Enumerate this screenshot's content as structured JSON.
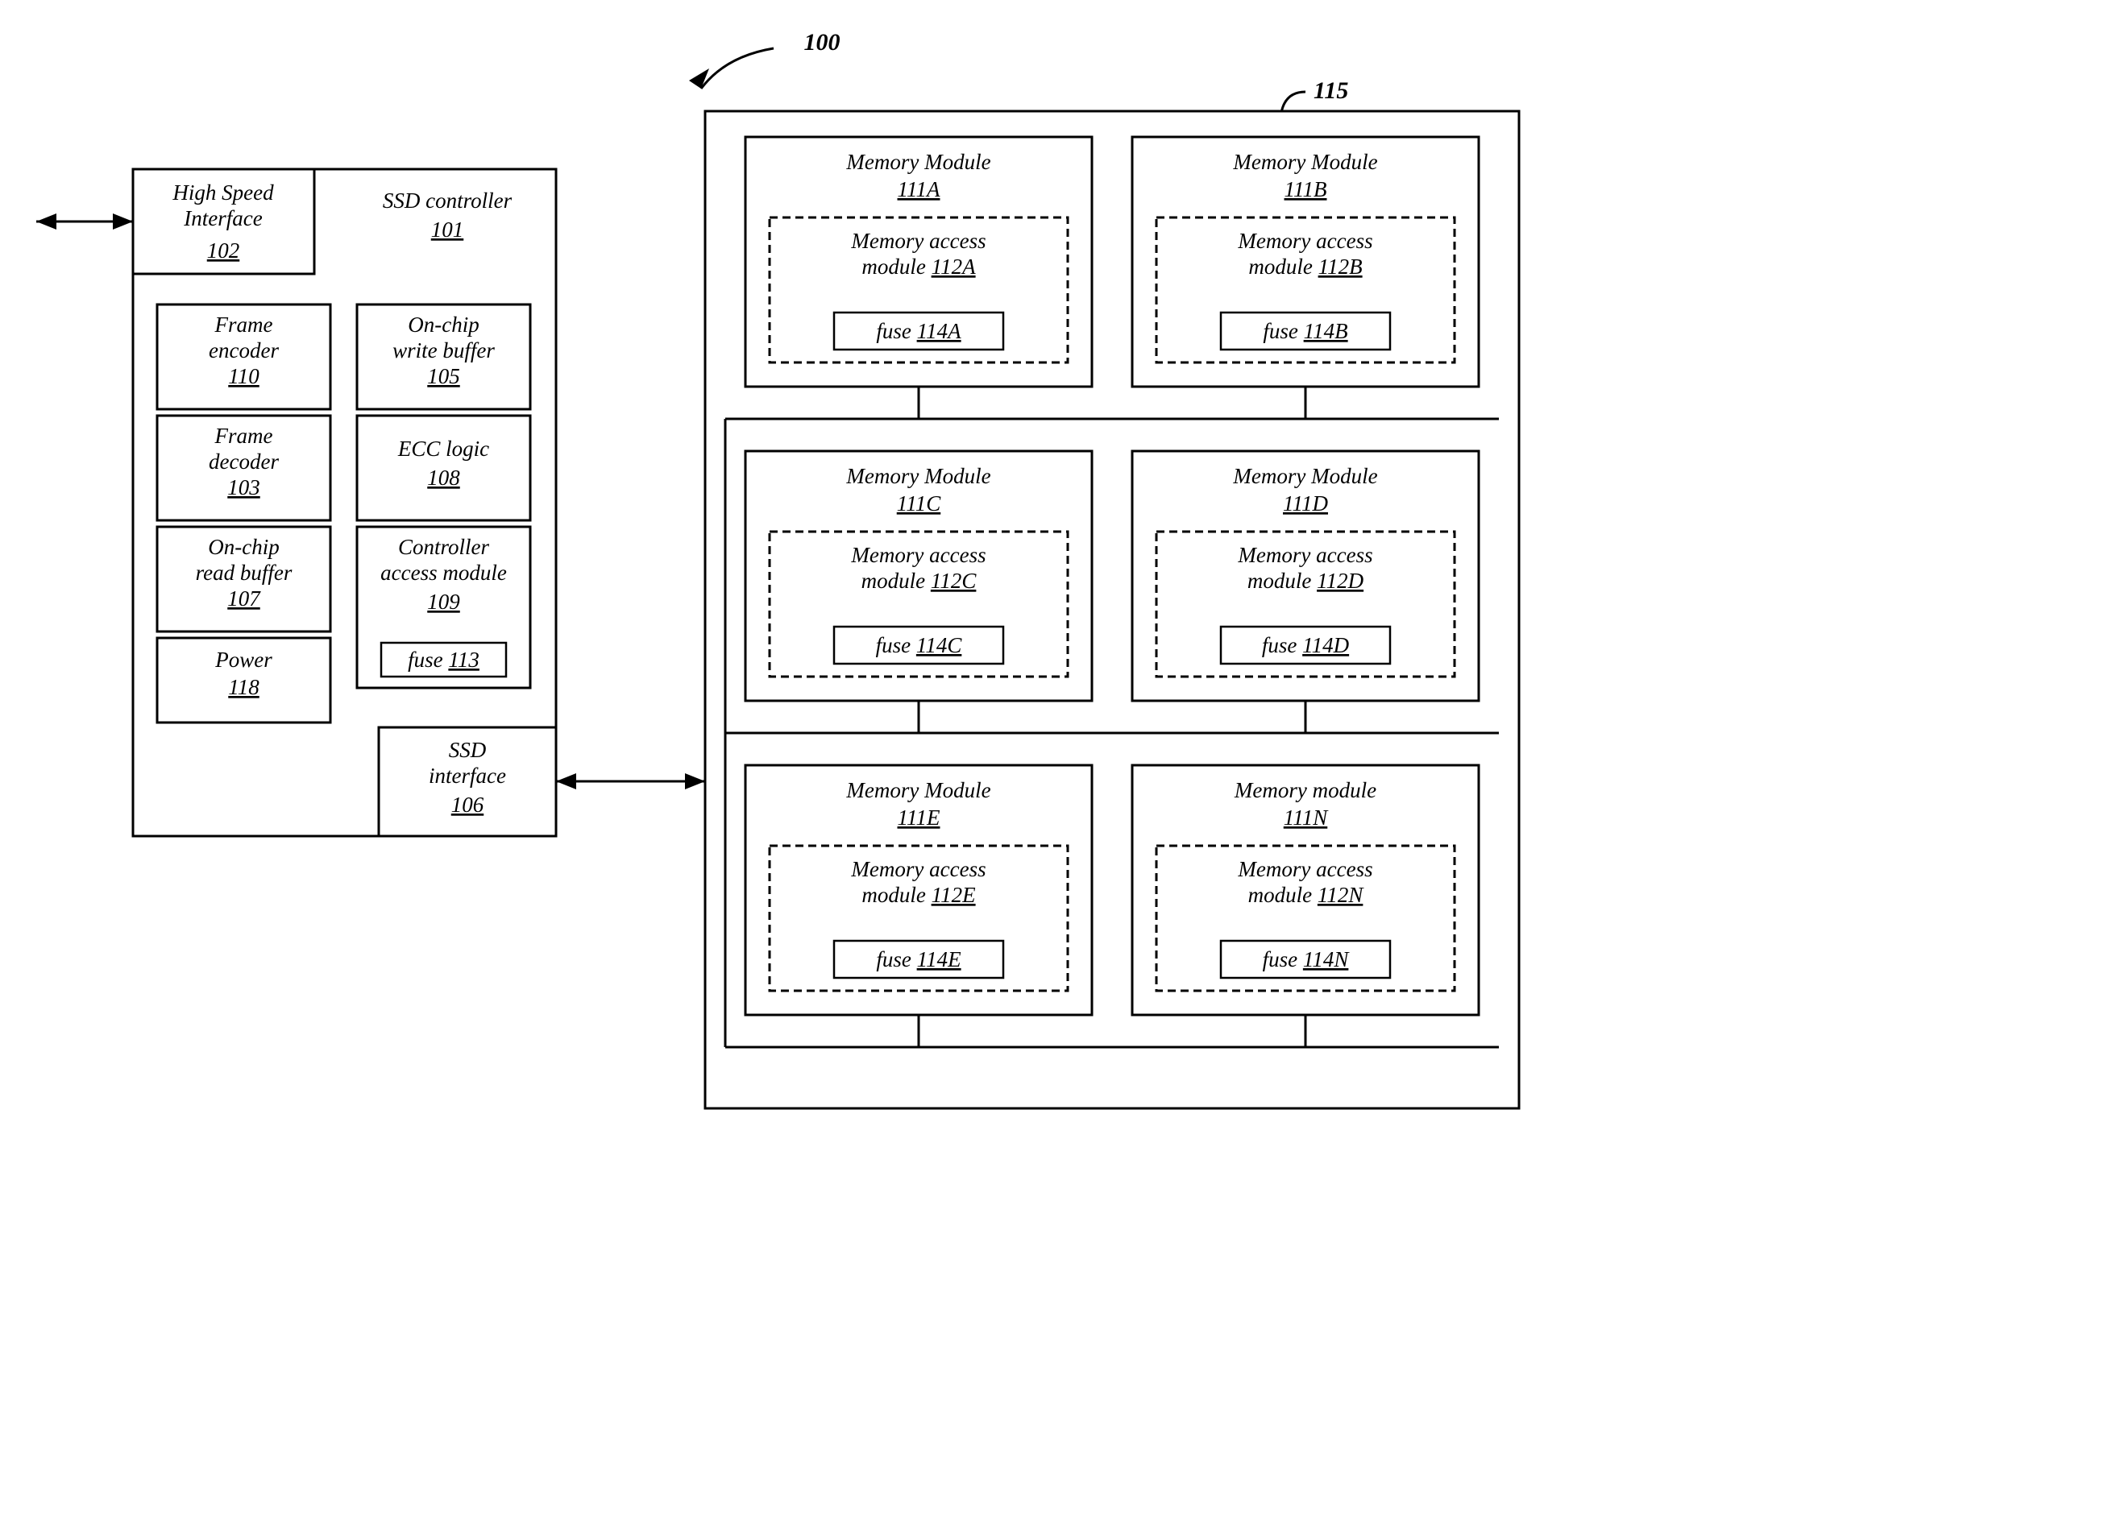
{
  "figure_ref": "100",
  "memory_array_ref": "115",
  "controller": {
    "title": "SSD controller",
    "ref": "101",
    "hs_iface": {
      "title": "High Speed\nInterface",
      "ref": "102"
    },
    "blocks": {
      "frame_encoder": {
        "title": "Frame\nencoder",
        "ref": "110"
      },
      "frame_decoder": {
        "title": "Frame\ndecoder",
        "ref": "103"
      },
      "read_buffer": {
        "title": "On-chip\nread buffer",
        "ref": "107"
      },
      "power": {
        "title": "Power",
        "ref": "118"
      },
      "write_buffer": {
        "title": "On-chip\nwrite buffer",
        "ref": "105"
      },
      "ecc": {
        "title": "ECC logic",
        "ref": "108"
      },
      "cam": {
        "title": "Controller\naccess module",
        "ref": "109",
        "fuse_prefix": "fuse",
        "fuse_ref": "113"
      },
      "ssd_iface": {
        "title": "SSD\ninterface",
        "ref": "106"
      }
    }
  },
  "memory_modules": [
    {
      "title": "Memory Module",
      "ref": "111A",
      "mam_prefix": "Memory access\nmodule",
      "mam_ref": "112A",
      "fuse_prefix": "fuse",
      "fuse_ref": "114A"
    },
    {
      "title": "Memory Module",
      "ref": "111B",
      "mam_prefix": "Memory access\nmodule",
      "mam_ref": "112B",
      "fuse_prefix": "fuse",
      "fuse_ref": "114B"
    },
    {
      "title": "Memory Module",
      "ref": "111C",
      "mam_prefix": "Memory access\nmodule",
      "mam_ref": "112C",
      "fuse_prefix": "fuse",
      "fuse_ref": "114C"
    },
    {
      "title": "Memory Module",
      "ref": "111D",
      "mam_prefix": "Memory access\nmodule",
      "mam_ref": "112D",
      "fuse_prefix": "fuse",
      "fuse_ref": "114D"
    },
    {
      "title": "Memory Module",
      "ref": "111E",
      "mam_prefix": "Memory access\nmodule",
      "mam_ref": "112E",
      "fuse_prefix": "fuse",
      "fuse_ref": "114E"
    },
    {
      "title": "Memory module",
      "ref": "111N",
      "mam_prefix": "Memory access\nmodule",
      "mam_ref": "112N",
      "fuse_prefix": "fuse",
      "fuse_ref": "114N"
    }
  ]
}
